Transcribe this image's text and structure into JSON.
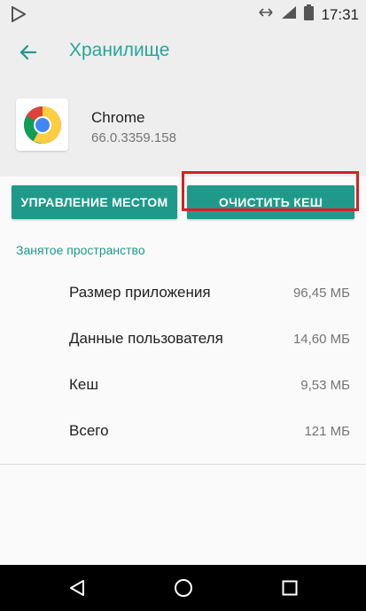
{
  "status_bar": {
    "time": "17:31",
    "icons": [
      "play-store-icon",
      "data-arrows-icon",
      "signal-icon",
      "battery-icon"
    ]
  },
  "header": {
    "title": "Хранилище"
  },
  "app": {
    "name": "Chrome",
    "version": "66.0.3359.158",
    "icon": "chrome-icon"
  },
  "actions": {
    "manage_label": "УПРАВЛЕНИЕ МЕСТОМ",
    "clear_cache_label": "ОЧИСТИТЬ КЕШ"
  },
  "storage": {
    "section_title": "Занятое пространство",
    "rows": [
      {
        "label": "Размер приложения",
        "value": "96,45 МБ"
      },
      {
        "label": "Данные пользователя",
        "value": "14,60 МБ"
      },
      {
        "label": "Кеш",
        "value": "9,53 МБ"
      },
      {
        "label": "Всего",
        "value": "121 МБ"
      }
    ]
  },
  "nav": {
    "icons": [
      "back-triangle-icon",
      "home-circle-icon",
      "recents-square-icon"
    ]
  },
  "colors": {
    "accent": "#1f9a8a",
    "highlight": "#d62020",
    "header_bg": "#eeeeee"
  }
}
